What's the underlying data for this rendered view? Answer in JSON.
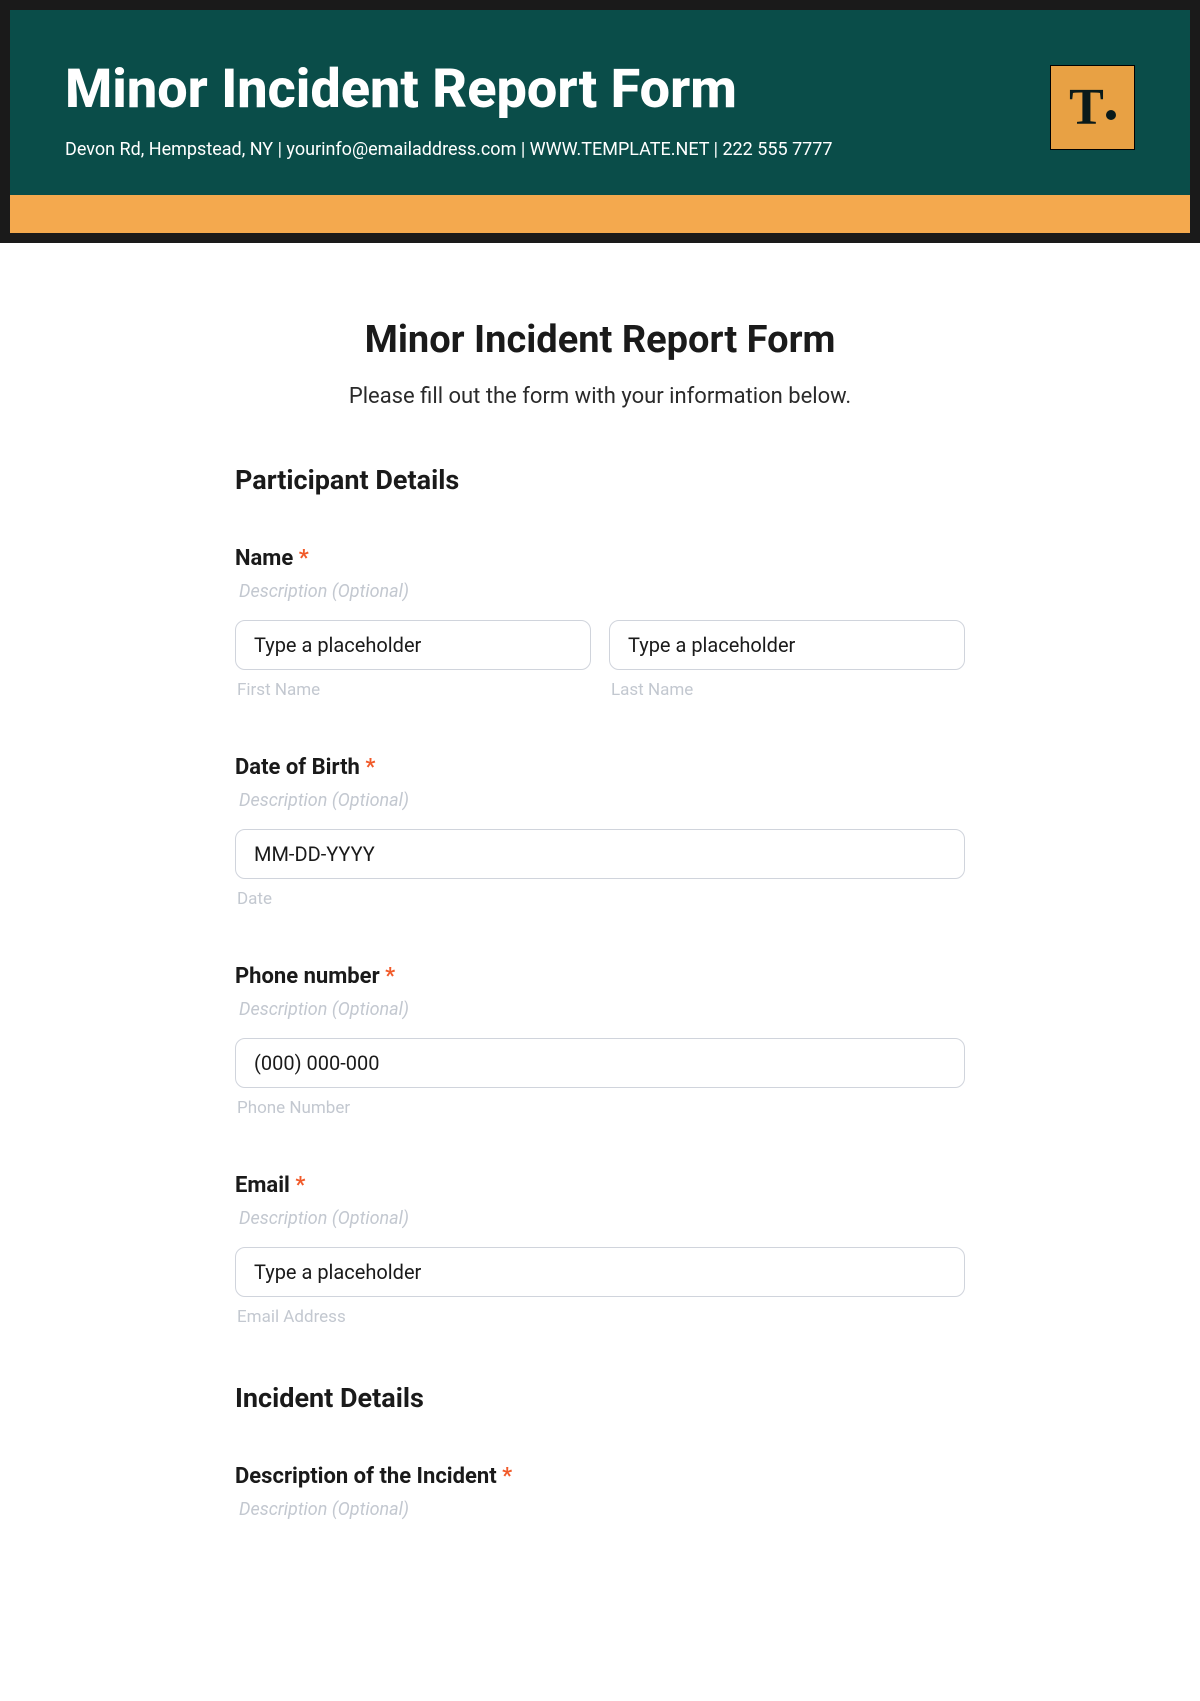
{
  "header": {
    "title": "Minor Incident Report Form",
    "subtitle": "Devon Rd, Hempstead, NY | yourinfo@emailaddress.com | WWW.TEMPLATE.NET | 222 555 7777",
    "logo_text": "T"
  },
  "form": {
    "title": "Minor Incident Report Form",
    "description": "Please fill out the form with your information below."
  },
  "sections": {
    "participant": {
      "title": "Participant Details",
      "name": {
        "label": "Name",
        "required": "*",
        "description": "Description (Optional)",
        "first_placeholder": "Type a placeholder",
        "last_placeholder": "Type a placeholder",
        "first_sublabel": "First Name",
        "last_sublabel": "Last Name"
      },
      "dob": {
        "label": "Date of Birth",
        "required": "*",
        "description": "Description (Optional)",
        "placeholder": "MM-DD-YYYY",
        "sublabel": "Date"
      },
      "phone": {
        "label": "Phone number",
        "required": "*",
        "description": "Description (Optional)",
        "placeholder": "(000) 000-000",
        "sublabel": "Phone Number"
      },
      "email": {
        "label": "Email",
        "required": "*",
        "description": "Description (Optional)",
        "placeholder": "Type a placeholder",
        "sublabel": "Email Address"
      }
    },
    "incident": {
      "title": "Incident Details",
      "description": {
        "label": "Description of the Incident",
        "required": "*",
        "description": "Description (Optional)"
      }
    }
  }
}
